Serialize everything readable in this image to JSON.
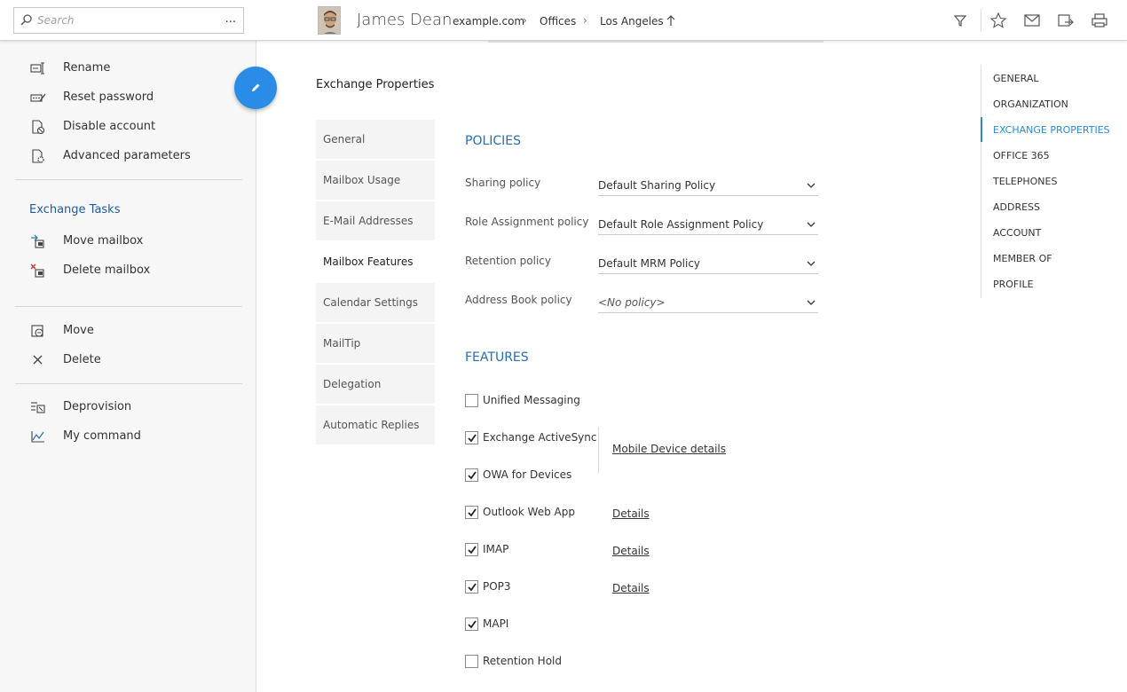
{
  "search": {
    "placeholder": "Search",
    "more_label": "..."
  },
  "user": {
    "name": "James Dean"
  },
  "breadcrumb": [
    "example.com",
    "Offices",
    "Los Angeles"
  ],
  "toolbar": [
    "filter-icon",
    "star-icon",
    "mail-icon",
    "export-icon",
    "print-icon"
  ],
  "actions_group1": [
    {
      "label": "Rename",
      "icon": "rename-icon"
    },
    {
      "label": "Reset password",
      "icon": "reset-password-icon"
    },
    {
      "label": "Disable account",
      "icon": "disable-account-icon"
    },
    {
      "label": "Advanced parameters",
      "icon": "advanced-parameters-icon"
    }
  ],
  "exchange_tasks": {
    "title": "Exchange Tasks",
    "items": [
      {
        "label": "Move mailbox",
        "icon": "move-mailbox-icon"
      },
      {
        "label": "Delete mailbox",
        "icon": "delete-mailbox-icon"
      }
    ]
  },
  "actions_group3": [
    {
      "label": "Move",
      "icon": "move-icon"
    },
    {
      "label": "Delete",
      "icon": "delete-icon"
    }
  ],
  "actions_group4": [
    {
      "label": "Deprovision",
      "icon": "deprovision-icon"
    },
    {
      "label": "My command",
      "icon": "my-command-icon"
    }
  ],
  "main": {
    "heading": "Exchange Properties",
    "subnav": [
      "General",
      "Mailbox Usage",
      "E-Mail Addresses",
      "Mailbox Features",
      "Calendar Settings",
      "MailTip",
      "Delegation",
      "Automatic Replies"
    ],
    "subnav_active": "Mailbox Features",
    "policies_title": "POLICIES",
    "policies": [
      {
        "label": "Sharing policy",
        "value": "Default Sharing Policy"
      },
      {
        "label": "Role Assignment policy",
        "value": "Default Role Assignment Policy"
      },
      {
        "label": "Retention policy",
        "value": "Default MRM Policy"
      },
      {
        "label": "Address Book policy",
        "value": "<No policy>"
      }
    ],
    "features_title": "FEATURES",
    "features": [
      {
        "label": "Unified Messaging",
        "checked": false
      },
      {
        "label": "Exchange ActiveSync",
        "checked": true
      },
      {
        "label": "OWA for Devices",
        "checked": true
      },
      {
        "label": "Outlook Web App",
        "checked": true
      },
      {
        "label": "IMAP",
        "checked": true
      },
      {
        "label": "POP3",
        "checked": true
      },
      {
        "label": "MAPI",
        "checked": true
      },
      {
        "label": "Retention Hold",
        "checked": false
      }
    ],
    "links": {
      "mobile_device": "Mobile Device details",
      "owa_details": "Details",
      "imap_details": "Details",
      "pop3_details": "Details"
    }
  },
  "rightnav": {
    "items": [
      "GENERAL",
      "ORGANIZATION",
      "EXCHANGE PROPERTIES",
      "OFFICE 365",
      "TELEPHONES",
      "ADDRESS",
      "ACCOUNT",
      "MEMBER OF",
      "PROFILE"
    ],
    "active": "EXCHANGE PROPERTIES"
  },
  "colors": {
    "accent": "#2a8ad6",
    "fab": "#2b8ce8",
    "section_title": "#1f5c99",
    "group_title": "#2a6db0"
  }
}
